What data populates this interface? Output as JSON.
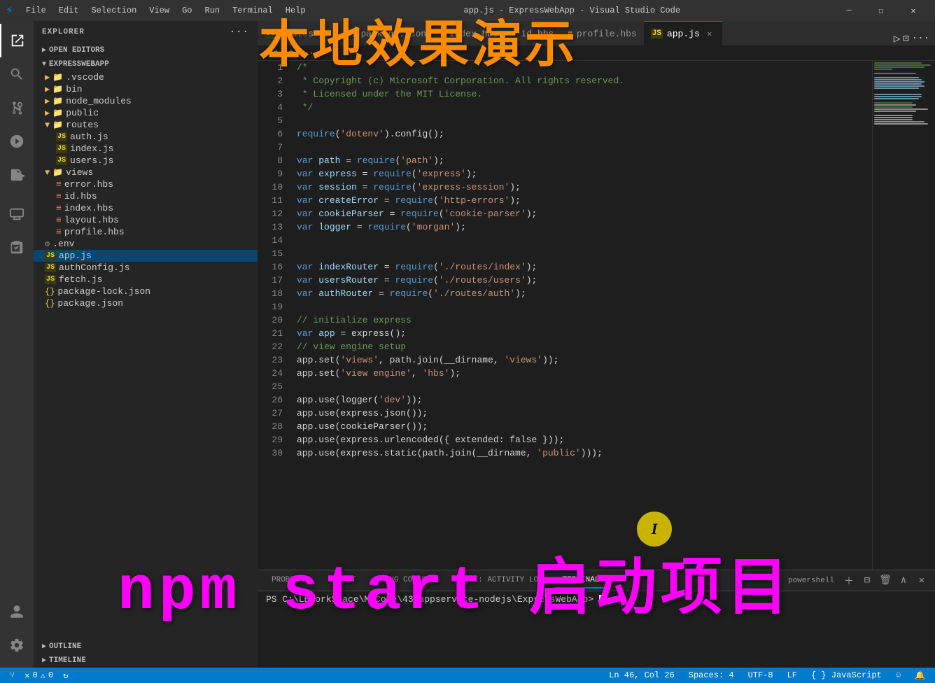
{
  "titlebar": {
    "icon": "⚡",
    "menu_items": [
      "File",
      "Edit",
      "Selection",
      "View",
      "Go",
      "Run",
      "Terminal",
      "Help"
    ],
    "title": "app.js - ExpressWebApp - Visual Studio Code",
    "controls": [
      "─",
      "☐",
      "✕"
    ]
  },
  "activitybar": {
    "items": [
      {
        "name": "explorer-icon",
        "icon": "⎘",
        "active": true
      },
      {
        "name": "search-icon",
        "icon": "🔍"
      },
      {
        "name": "source-control-icon",
        "icon": "⑂"
      },
      {
        "name": "run-debug-icon",
        "icon": "▷"
      },
      {
        "name": "extensions-icon",
        "icon": "⊞"
      },
      {
        "name": "remote-explorer-icon",
        "icon": "🖥"
      },
      {
        "name": "test-icon",
        "icon": "⚗"
      }
    ],
    "bottom_items": [
      {
        "name": "accounts-icon",
        "icon": "👤"
      },
      {
        "name": "settings-icon",
        "icon": "⚙"
      }
    ]
  },
  "sidebar": {
    "title": "EXPLORER",
    "sections": {
      "open_editors": "OPEN EDITORS",
      "project": "EXPRESSWEBAPP"
    },
    "file_tree": [
      {
        "indent": 1,
        "type": "folder",
        "label": ".vscode",
        "icon": "▶",
        "collapsed": true
      },
      {
        "indent": 1,
        "type": "folder",
        "label": "bin",
        "icon": "▶",
        "collapsed": true
      },
      {
        "indent": 1,
        "type": "folder",
        "label": "node_modules",
        "icon": "▶",
        "collapsed": true
      },
      {
        "indent": 1,
        "type": "folder",
        "label": "public",
        "icon": "▶",
        "collapsed": true
      },
      {
        "indent": 1,
        "type": "folder",
        "label": "routes",
        "icon": "▼",
        "collapsed": false
      },
      {
        "indent": 2,
        "type": "js",
        "label": "auth.js"
      },
      {
        "indent": 2,
        "type": "js",
        "label": "index.js"
      },
      {
        "indent": 2,
        "type": "js",
        "label": "users.js"
      },
      {
        "indent": 1,
        "type": "folder",
        "label": "views",
        "icon": "▼",
        "collapsed": false
      },
      {
        "indent": 2,
        "type": "hbs",
        "label": "error.hbs"
      },
      {
        "indent": 2,
        "type": "hbs",
        "label": "id.hbs"
      },
      {
        "indent": 2,
        "type": "hbs",
        "label": "index.hbs"
      },
      {
        "indent": 2,
        "type": "hbs",
        "label": "layout.hbs"
      },
      {
        "indent": 2,
        "type": "hbs",
        "label": "profile.hbs"
      },
      {
        "indent": 1,
        "type": "env",
        "label": ".env"
      },
      {
        "indent": 1,
        "type": "js",
        "label": "app.js",
        "selected": true
      },
      {
        "indent": 1,
        "type": "js",
        "label": "authConfig.js"
      },
      {
        "indent": 1,
        "type": "js",
        "label": "fetch.js"
      },
      {
        "indent": 1,
        "type": "json",
        "label": "package-lock.json"
      },
      {
        "indent": 1,
        "type": "json",
        "label": "package.json"
      }
    ],
    "outline": "OUTLINE",
    "timeline": "TIMELINE"
  },
  "tabs": [
    {
      "label": "routes.js",
      "type": "js",
      "active": false
    },
    {
      "label": "package.json",
      "type": "json",
      "active": false
    },
    {
      "label": "index.hbs",
      "type": "hbs",
      "active": false
    },
    {
      "label": "id.hbs",
      "type": "hbs",
      "active": false
    },
    {
      "label": "profile.hbs",
      "type": "hbs",
      "active": false
    },
    {
      "label": "app.js",
      "type": "js",
      "active": true,
      "closable": true
    }
  ],
  "breadcrumb": [
    "app.js",
    ">",
    "..."
  ],
  "code_lines": [
    {
      "num": 1,
      "content": "/*"
    },
    {
      "num": 2,
      "content": " * Copyright (c) Microsoft Corporation. All rights reserved."
    },
    {
      "num": 3,
      "content": " * Licensed under the MIT License."
    },
    {
      "num": 4,
      "content": " */"
    },
    {
      "num": 5,
      "content": ""
    },
    {
      "num": 6,
      "content": "require('dotenv').config();"
    },
    {
      "num": 7,
      "content": ""
    },
    {
      "num": 8,
      "content": "var path = require('path');"
    },
    {
      "num": 9,
      "content": "var express = require('express');"
    },
    {
      "num": 10,
      "content": "var session = require('express-session');"
    },
    {
      "num": 11,
      "content": "var createError = require('http-errors');"
    },
    {
      "num": 12,
      "content": "var cookieParser = require('cookie-parser');"
    },
    {
      "num": 13,
      "content": "var logger = require('morgan');"
    },
    {
      "num": 14,
      "content": ""
    },
    {
      "num": 15,
      "content": ""
    },
    {
      "num": 16,
      "content": "var indexRouter = require('./routes/index');"
    },
    {
      "num": 17,
      "content": "var usersRouter = require('./routes/users');"
    },
    {
      "num": 18,
      "content": "var authRouter = require('./routes/auth');"
    },
    {
      "num": 19,
      "content": ""
    },
    {
      "num": 20,
      "content": "// initialize express"
    },
    {
      "num": 21,
      "content": "var app = express();"
    },
    {
      "num": 22,
      "content": "// view engine setup"
    },
    {
      "num": 23,
      "content": "app.set('views', path.join(__dirname, 'views'));"
    },
    {
      "num": 24,
      "content": "app.set('view engine', 'hbs');"
    },
    {
      "num": 25,
      "content": ""
    },
    {
      "num": 26,
      "content": "app.use(logger('dev'));"
    },
    {
      "num": 27,
      "content": "app.use(express.json());"
    },
    {
      "num": 28,
      "content": "app.use(cookieParser());"
    },
    {
      "num": 29,
      "content": "app.use(express.urlencoded({ extended: false }));"
    },
    {
      "num": 30,
      "content": "app.use(express.static(path.join(__dirname, 'public')));"
    }
  ],
  "panel": {
    "tabs": [
      "PROBLEMS",
      "OUTPUT",
      "DEBUG CONSOLE",
      "AZURE: ACTIVITY LOG",
      "TERMINAL"
    ],
    "active_tab": "TERMINAL",
    "terminal": {
      "shell_label": "powershell",
      "prompt": "PS C:\\LBWorkSpace\\MyCode\\43-appservice-nodejs\\ExpressWebApp> "
    }
  },
  "statusbar": {
    "left": {
      "branch_icon": "⑂",
      "errors": "0",
      "warnings": "0",
      "sync_icon": "↻"
    },
    "right": {
      "position": "Ln 46, Col 26",
      "spaces": "Spaces: 4",
      "encoding": "UTF-8",
      "line_ending": "LF",
      "language_brace": "{ }",
      "language": "JavaScript",
      "feedback_icon": "☺",
      "notifications_icon": "🔔"
    }
  },
  "overlay": {
    "top_text": "本地效果演示",
    "bottom_text": "npm start 启动项目"
  }
}
